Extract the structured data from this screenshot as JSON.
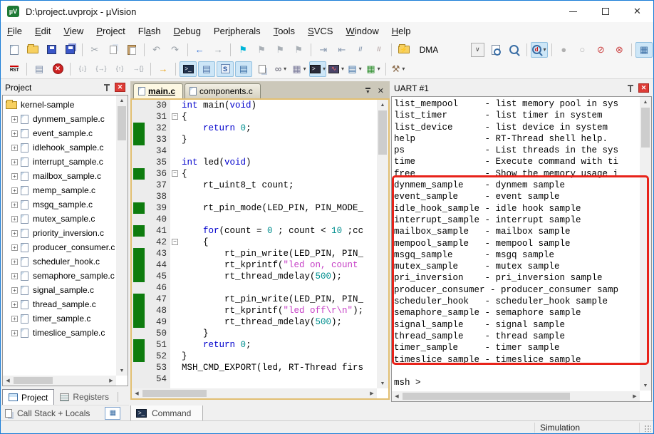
{
  "window": {
    "title": "D:\\project.uvprojx - µVision",
    "app_icon": "µV"
  },
  "icons": {
    "scroll_up": "▲",
    "scroll_down": "▼",
    "scroll_left": "◀",
    "scroll_right": "▶",
    "chevron_down": "∨",
    "caret": "▾",
    "tab_menu": "▼",
    "close": "✕",
    "plus": "+"
  },
  "menu": {
    "items": [
      {
        "label": "File",
        "u": 0
      },
      {
        "label": "Edit",
        "u": 0
      },
      {
        "label": "View",
        "u": 0
      },
      {
        "label": "Project",
        "u": 0
      },
      {
        "label": "Flash",
        "u": 2
      },
      {
        "label": "Debug",
        "u": 0
      },
      {
        "label": "Peripherals",
        "u": 3
      },
      {
        "label": "Tools",
        "u": 0
      },
      {
        "label": "SVCS",
        "u": 0
      },
      {
        "label": "Window",
        "u": 0
      },
      {
        "label": "Help",
        "u": 0
      }
    ]
  },
  "toolbar1": {
    "target_combo": {
      "value": "DMA"
    },
    "items": [
      {
        "name": "new-file-button",
        "icon": "css-page"
      },
      {
        "name": "open-file-button",
        "icon": "css-folder"
      },
      {
        "name": "save-button",
        "icon": "css-disk"
      },
      {
        "name": "save-all-button",
        "icon": "css-disk2"
      },
      {
        "sep": true
      },
      {
        "name": "cut-button",
        "g": "✂",
        "color": "#9aa1a8"
      },
      {
        "name": "copy-button",
        "icon": "css-copy"
      },
      {
        "name": "paste-button",
        "icon": "css-paste"
      },
      {
        "sep": true
      },
      {
        "name": "undo-button",
        "g": "↶",
        "color": "#9aa1a8"
      },
      {
        "name": "redo-button",
        "g": "↷",
        "color": "#9aa1a8"
      },
      {
        "sep": true
      },
      {
        "name": "navigate-back-button",
        "g": "←",
        "color": "#2a6ad4",
        "bold": true
      },
      {
        "name": "navigate-forward-button",
        "g": "→",
        "color": "#9aa1a8",
        "bold": true
      },
      {
        "sep": true
      },
      {
        "name": "toggle-bookmark-button",
        "g": "⚑",
        "color": "#00b5d8"
      },
      {
        "name": "next-bookmark-button",
        "g": "⚑",
        "color": "#aab0b6"
      },
      {
        "name": "prev-bookmark-button",
        "g": "⚑",
        "color": "#aab0b6"
      },
      {
        "name": "clear-bookmarks-button",
        "g": "⚑",
        "color": "#aab0b6"
      },
      {
        "sep": true
      },
      {
        "name": "indent-button",
        "g": "⇥",
        "color": "#8a9ab0"
      },
      {
        "name": "unindent-button",
        "g": "⇤",
        "color": "#8a9ab0"
      },
      {
        "name": "comment-button",
        "g": "//",
        "color": "#8a9ab0",
        "bold": true,
        "small": true
      },
      {
        "name": "uncomment-button",
        "g": "//",
        "color": "#b0a0a0",
        "bold": true,
        "small": true
      },
      {
        "sep": true
      },
      {
        "name": "download-flash-button",
        "icon": "css-folder",
        "g": "⚡",
        "color": "#443300",
        "small": true
      },
      {
        "combo": true,
        "name": "target-select"
      },
      {
        "name": "find-in-files-button",
        "icon": "css-pagemag"
      },
      {
        "name": "find-next-button",
        "icon": "css-mag"
      },
      {
        "sep": true
      },
      {
        "name": "incremental-find-button",
        "icon": "css-mag",
        "g": "d",
        "color": "#cc1111",
        "small": true,
        "active": true,
        "caret": true
      },
      {
        "sep": true
      },
      {
        "name": "insert-breakpoint-button",
        "g": "●",
        "color": "#b0b0b0"
      },
      {
        "name": "enable-breakpoint-button",
        "g": "○",
        "color": "#b0b0b0"
      },
      {
        "name": "disable-all-breakpoints-button",
        "g": "⊘",
        "color": "#cc4444"
      },
      {
        "name": "kill-all-breakpoints-button",
        "g": "⊗",
        "color": "#cc4444"
      },
      {
        "sep": true
      },
      {
        "name": "window-layout-button",
        "g": "▦",
        "color": "#3a6ea5",
        "active": true
      }
    ]
  },
  "toolbar2": {
    "items": [
      {
        "name": "reset-button",
        "icon": "css-rst",
        "g": "RST"
      },
      {
        "sep": true
      },
      {
        "name": "run-button",
        "g": "▤",
        "color": "#7a8ca8"
      },
      {
        "name": "stop-button",
        "icon": "css-stop",
        "g": "✕"
      },
      {
        "sep": true
      },
      {
        "name": "step-button",
        "g": "{↓}",
        "color": "#9aa1a8",
        "small": true
      },
      {
        "name": "step-over-button",
        "g": "{→}",
        "color": "#9aa1a8",
        "small": true
      },
      {
        "name": "step-out-button",
        "g": "{↑}",
        "color": "#9aa1a8",
        "small": true
      },
      {
        "name": "run-to-cursor-button",
        "g": "→{}",
        "color": "#9aa1a8",
        "small": true
      },
      {
        "sep": true
      },
      {
        "name": "show-next-statement-button",
        "g": "→",
        "color": "#e89a00",
        "bold": true
      },
      {
        "sep": true
      },
      {
        "name": "command-window-button",
        "icon": "css-cmd",
        "g": ">_",
        "active": true
      },
      {
        "name": "disassembly-window-button",
        "g": "▤",
        "color": "#5577aa",
        "active": true
      },
      {
        "name": "symbol-window-button",
        "icon": "css-sym",
        "g": "S",
        "active": true
      },
      {
        "name": "registers-window-button",
        "g": "▤",
        "color": "#3a6ea5",
        "active": true
      },
      {
        "name": "call-stack-window-button",
        "icon": "css-pages"
      },
      {
        "name": "watch-window-button",
        "g": "∞",
        "color": "#555566",
        "caret": true
      },
      {
        "name": "memory-window-button",
        "g": "▦",
        "color": "#7a7a9a",
        "caret": true
      },
      {
        "name": "serial-window-button",
        "icon": "css-serial",
        "g": ">",
        "active": true,
        "caret": true
      },
      {
        "name": "logic-analyzer-button",
        "icon": "css-wave",
        "g": "∿",
        "caret": true
      },
      {
        "name": "system-viewer-button",
        "g": "▤",
        "color": "#3a6ea5",
        "caret": true
      },
      {
        "name": "toolbox-button",
        "g": "▦",
        "color": "#2f8f2f",
        "caret": true
      },
      {
        "sep": true
      },
      {
        "name": "debug-settings-button",
        "g": "⚒",
        "color": "#8a6a4a",
        "caret": true
      }
    ]
  },
  "project_panel": {
    "title": "Project",
    "root": "kernel-sample",
    "files": [
      "dynmem_sample.c",
      "event_sample.c",
      "idlehook_sample.c",
      "interrupt_sample.c",
      "mailbox_sample.c",
      "memp_sample.c",
      "msgq_sample.c",
      "mutex_sample.c",
      "priority_inversion.c",
      "producer_consumer.c",
      "scheduler_hook.c",
      "semaphore_sample.c",
      "signal_sample.c",
      "thread_sample.c",
      "timer_sample.c",
      "timeslice_sample.c"
    ],
    "tabs": [
      {
        "label": "Project"
      },
      {
        "label": "Registers"
      }
    ],
    "callstack_label": "Call Stack + Locals"
  },
  "editor": {
    "tabs": [
      {
        "label": "main.c"
      },
      {
        "label": "components.c"
      }
    ],
    "lines": [
      {
        "n": 30,
        "segs": [
          [
            "tk",
            "int"
          ],
          [
            "td",
            " main("
          ],
          [
            "tk",
            "void"
          ],
          [
            "td",
            ")"
          ]
        ]
      },
      {
        "n": 31,
        "fold": true,
        "segs": [
          [
            "td",
            "{"
          ]
        ]
      },
      {
        "n": 32,
        "g": true,
        "segs": [
          [
            "td",
            "    "
          ],
          [
            "tk",
            "return"
          ],
          [
            "td",
            " "
          ],
          [
            "tn",
            "0"
          ],
          [
            "td",
            ";"
          ]
        ]
      },
      {
        "n": 33,
        "g": true,
        "segs": [
          [
            "td",
            "}"
          ]
        ]
      },
      {
        "n": 34,
        "segs": []
      },
      {
        "n": 35,
        "segs": [
          [
            "tk",
            "int"
          ],
          [
            "td",
            " led("
          ],
          [
            "tk",
            "void"
          ],
          [
            "td",
            ")"
          ]
        ]
      },
      {
        "n": 36,
        "g": true,
        "fold": true,
        "segs": [
          [
            "td",
            "{"
          ]
        ]
      },
      {
        "n": 37,
        "segs": [
          [
            "td",
            "    rt_uint8_t count;"
          ]
        ]
      },
      {
        "n": 38,
        "segs": []
      },
      {
        "n": 39,
        "g": true,
        "segs": [
          [
            "td",
            "    rt_pin_mode(LED_PIN, PIN_MODE_"
          ]
        ]
      },
      {
        "n": 40,
        "segs": []
      },
      {
        "n": 41,
        "g": true,
        "segs": [
          [
            "td",
            "    "
          ],
          [
            "tk",
            "for"
          ],
          [
            "td",
            "(count = "
          ],
          [
            "tn",
            "0"
          ],
          [
            "td",
            " ; count < "
          ],
          [
            "tn",
            "10"
          ],
          [
            "td",
            " ;cc"
          ]
        ]
      },
      {
        "n": 42,
        "fold": true,
        "segs": [
          [
            "td",
            "    {"
          ]
        ]
      },
      {
        "n": 43,
        "g": true,
        "segs": [
          [
            "td",
            "        rt_pin_write(LED_PIN, PIN_"
          ]
        ]
      },
      {
        "n": 44,
        "g": true,
        "segs": [
          [
            "td",
            "        rt_kprintf("
          ],
          [
            "ts",
            "\"led on, count "
          ]
        ]
      },
      {
        "n": 45,
        "g": true,
        "segs": [
          [
            "td",
            "        rt_thread_mdelay("
          ],
          [
            "tn",
            "500"
          ],
          [
            "td",
            ");"
          ]
        ]
      },
      {
        "n": 46,
        "segs": []
      },
      {
        "n": 47,
        "g": true,
        "segs": [
          [
            "td",
            "        rt_pin_write(LED_PIN, PIN_"
          ]
        ]
      },
      {
        "n": 48,
        "g": true,
        "segs": [
          [
            "td",
            "        rt_kprintf("
          ],
          [
            "ts",
            "\"led off\\r\\n\""
          ],
          [
            "td",
            ");"
          ]
        ]
      },
      {
        "n": 49,
        "g": true,
        "segs": [
          [
            "td",
            "        rt_thread_mdelay("
          ],
          [
            "tn",
            "500"
          ],
          [
            "td",
            ");"
          ]
        ]
      },
      {
        "n": 50,
        "segs": [
          [
            "td",
            "    }"
          ]
        ]
      },
      {
        "n": 51,
        "g": true,
        "segs": [
          [
            "td",
            "    "
          ],
          [
            "tk",
            "return"
          ],
          [
            "td",
            " "
          ],
          [
            "tn",
            "0"
          ],
          [
            "td",
            ";"
          ]
        ]
      },
      {
        "n": 52,
        "g": true,
        "segs": [
          [
            "td",
            "}"
          ]
        ]
      },
      {
        "n": 53,
        "segs": [
          [
            "td",
            "MSH_CMD_EXPORT(led, RT-Thread firs"
          ]
        ]
      },
      {
        "n": 54,
        "segs": []
      }
    ]
  },
  "uart": {
    "title": "UART #1",
    "lines": [
      "list_mempool     - list memory pool in sys",
      "list_timer       - list timer in system",
      "list_device      - list device in system",
      "help             - RT-Thread shell help.",
      "ps               - List threads in the sys",
      "time             - Execute command with ti",
      "free             - Show the memory usage i",
      "dynmem_sample    - dynmem sample",
      "event_sample     - event sample",
      "idle_hook_sample - idle hook sample",
      "interrupt_sample - interrupt sample",
      "mailbox_sample   - mailbox sample",
      "mempool_sample   - mempool sample",
      "msgq_sample      - msgq sample",
      "mutex_sample     - mutex sample",
      "pri_inversion    - pri_inversion sample",
      "producer_consumer - producer_consumer samp",
      "scheduler_hook   - scheduler_hook sample",
      "semaphore_sample - semaphore sample",
      "signal_sample    - signal sample",
      "thread_sample    - thread sample",
      "timer_sample     - timer sample",
      "timeslice_sample - timeslice sample",
      "",
      "msh >"
    ]
  },
  "command_tab": {
    "label": "Command"
  },
  "status_bar": {
    "text": "Simulation"
  },
  "colors": {
    "window_border": "#1a7dd7",
    "annotation_red": "#e8231a",
    "exec_green": "#0e7c0e",
    "keyword": "#0000cc",
    "number": "#008f8f",
    "string": "#c63fc6",
    "editor_frame": "#e2bf72"
  }
}
